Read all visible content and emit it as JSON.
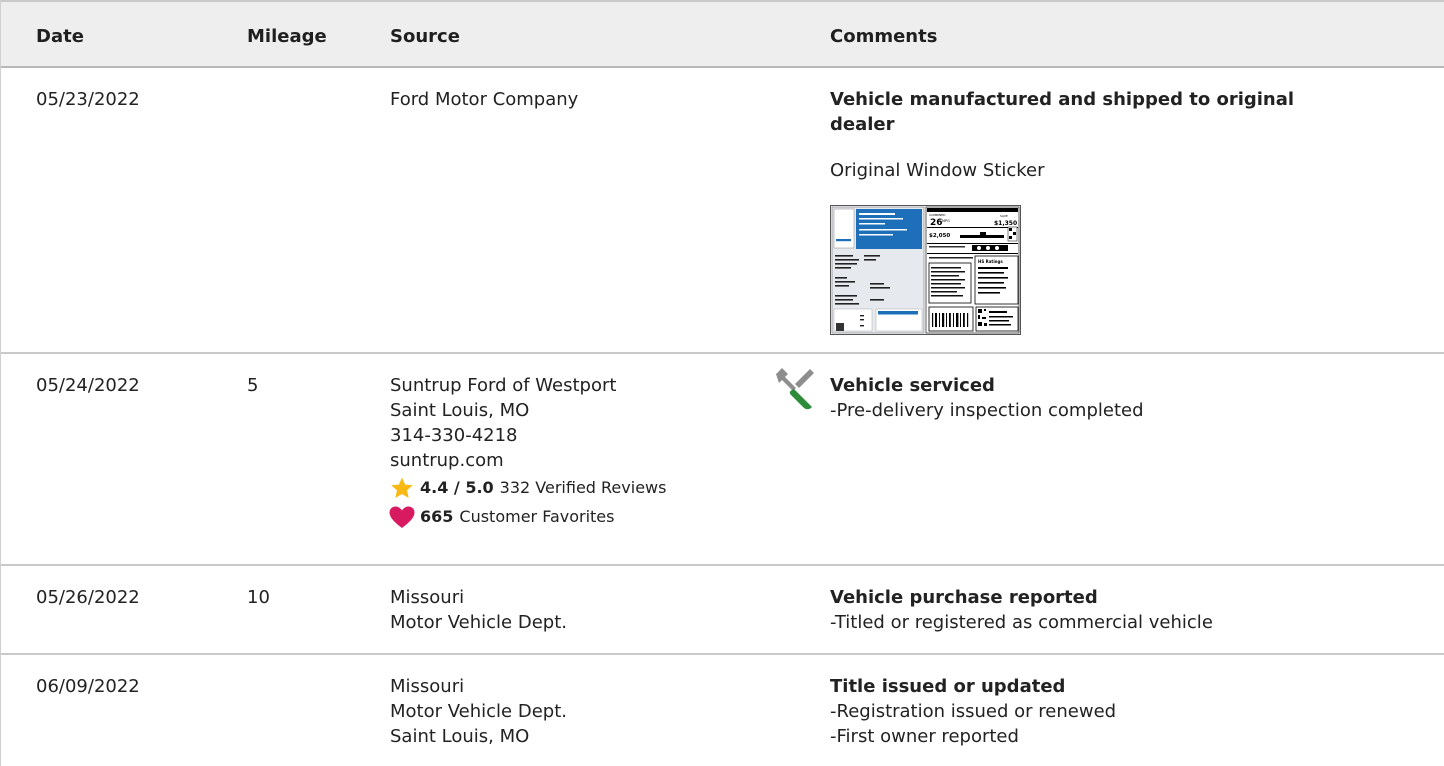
{
  "table": {
    "headers": {
      "date": "Date",
      "mileage": "Mileage",
      "source": "Source",
      "comments": "Comments"
    },
    "rows": [
      {
        "date": "05/23/2022",
        "mileage": "",
        "source": [
          "Ford Motor Company"
        ],
        "comment_title_lines": [
          "Vehicle manufactured and shipped to original",
          "dealer"
        ],
        "sticker_label": "Original Window Sticker",
        "sticker": {
          "mpg": "26",
          "mpg_unit": "MPG",
          "save_label": "SAVE",
          "save": "$1,350",
          "fuel_cost": "$2,050",
          "ratings_label": "HS Ratings"
        }
      },
      {
        "date": "05/24/2022",
        "mileage": "5",
        "source": [
          "Suntrup Ford of Westport",
          "Saint Louis, MO",
          "314-330-4218",
          "suntrup.com"
        ],
        "rating": "4.4 / 5.0",
        "reviews": "332 Verified Reviews",
        "favorites_count": "665",
        "favorites_label": "Customer Favorites",
        "comment_title": "Vehicle serviced",
        "comment_details": [
          "-Pre-delivery inspection completed"
        ]
      },
      {
        "date": "05/26/2022",
        "mileage": "10",
        "source": [
          "Missouri",
          "Motor Vehicle Dept."
        ],
        "comment_title": "Vehicle purchase reported",
        "comment_details": [
          "-Titled or registered as commercial vehicle"
        ]
      },
      {
        "date": "06/09/2022",
        "mileage": "",
        "source": [
          "Missouri",
          "Motor Vehicle Dept.",
          "Saint Louis, MO"
        ],
        "comment_title": "Title issued or updated",
        "comment_details": [
          "-Registration issued or renewed",
          "-First owner reported"
        ]
      }
    ]
  },
  "colors": {
    "header_bg": "#eeeeee",
    "star": "#f9b914",
    "heart": "#d81b60",
    "wrench_green": "#2e8b3a",
    "sticker_blue": "#1c6fb8"
  },
  "icons": {
    "service": "wrench-screwdriver-icon",
    "rating": "star-icon",
    "favorites": "heart-icon"
  }
}
